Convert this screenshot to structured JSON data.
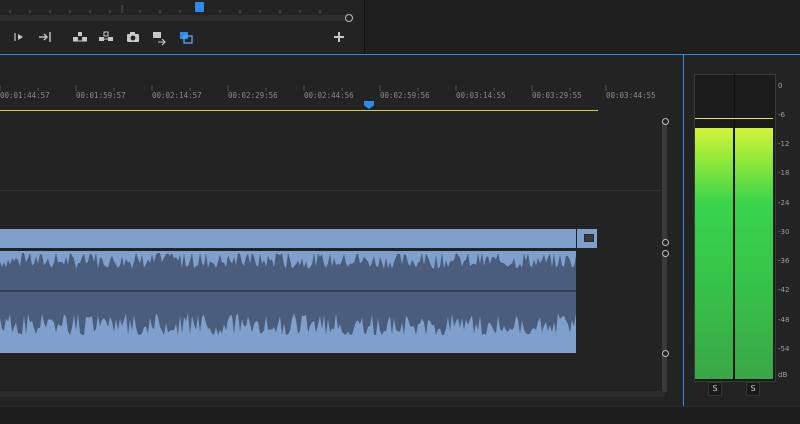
{
  "timecodes": [
    "00:01:44:57",
    "00:01:59:57",
    "00:02:14:57",
    "00:02:29:56",
    "00:02:44:56",
    "00:02:59:56",
    "00:03:14:55",
    "00:03:29:55",
    "00:03:44:55"
  ],
  "meter": {
    "scale": [
      "0",
      "-6",
      "-12",
      "-18",
      "-24",
      "-30",
      "-36",
      "-42",
      "-48",
      "-54",
      "dB"
    ],
    "solo_left": "S",
    "solo_right": "S",
    "gradient_top": "#d3f33a",
    "gradient_bottom": "#39a744",
    "peak_color": "#e8e05c"
  },
  "colors": {
    "accent": "#2d8ceb",
    "clip": "#7f9fcd",
    "ruler_line": "#d8c94a"
  }
}
